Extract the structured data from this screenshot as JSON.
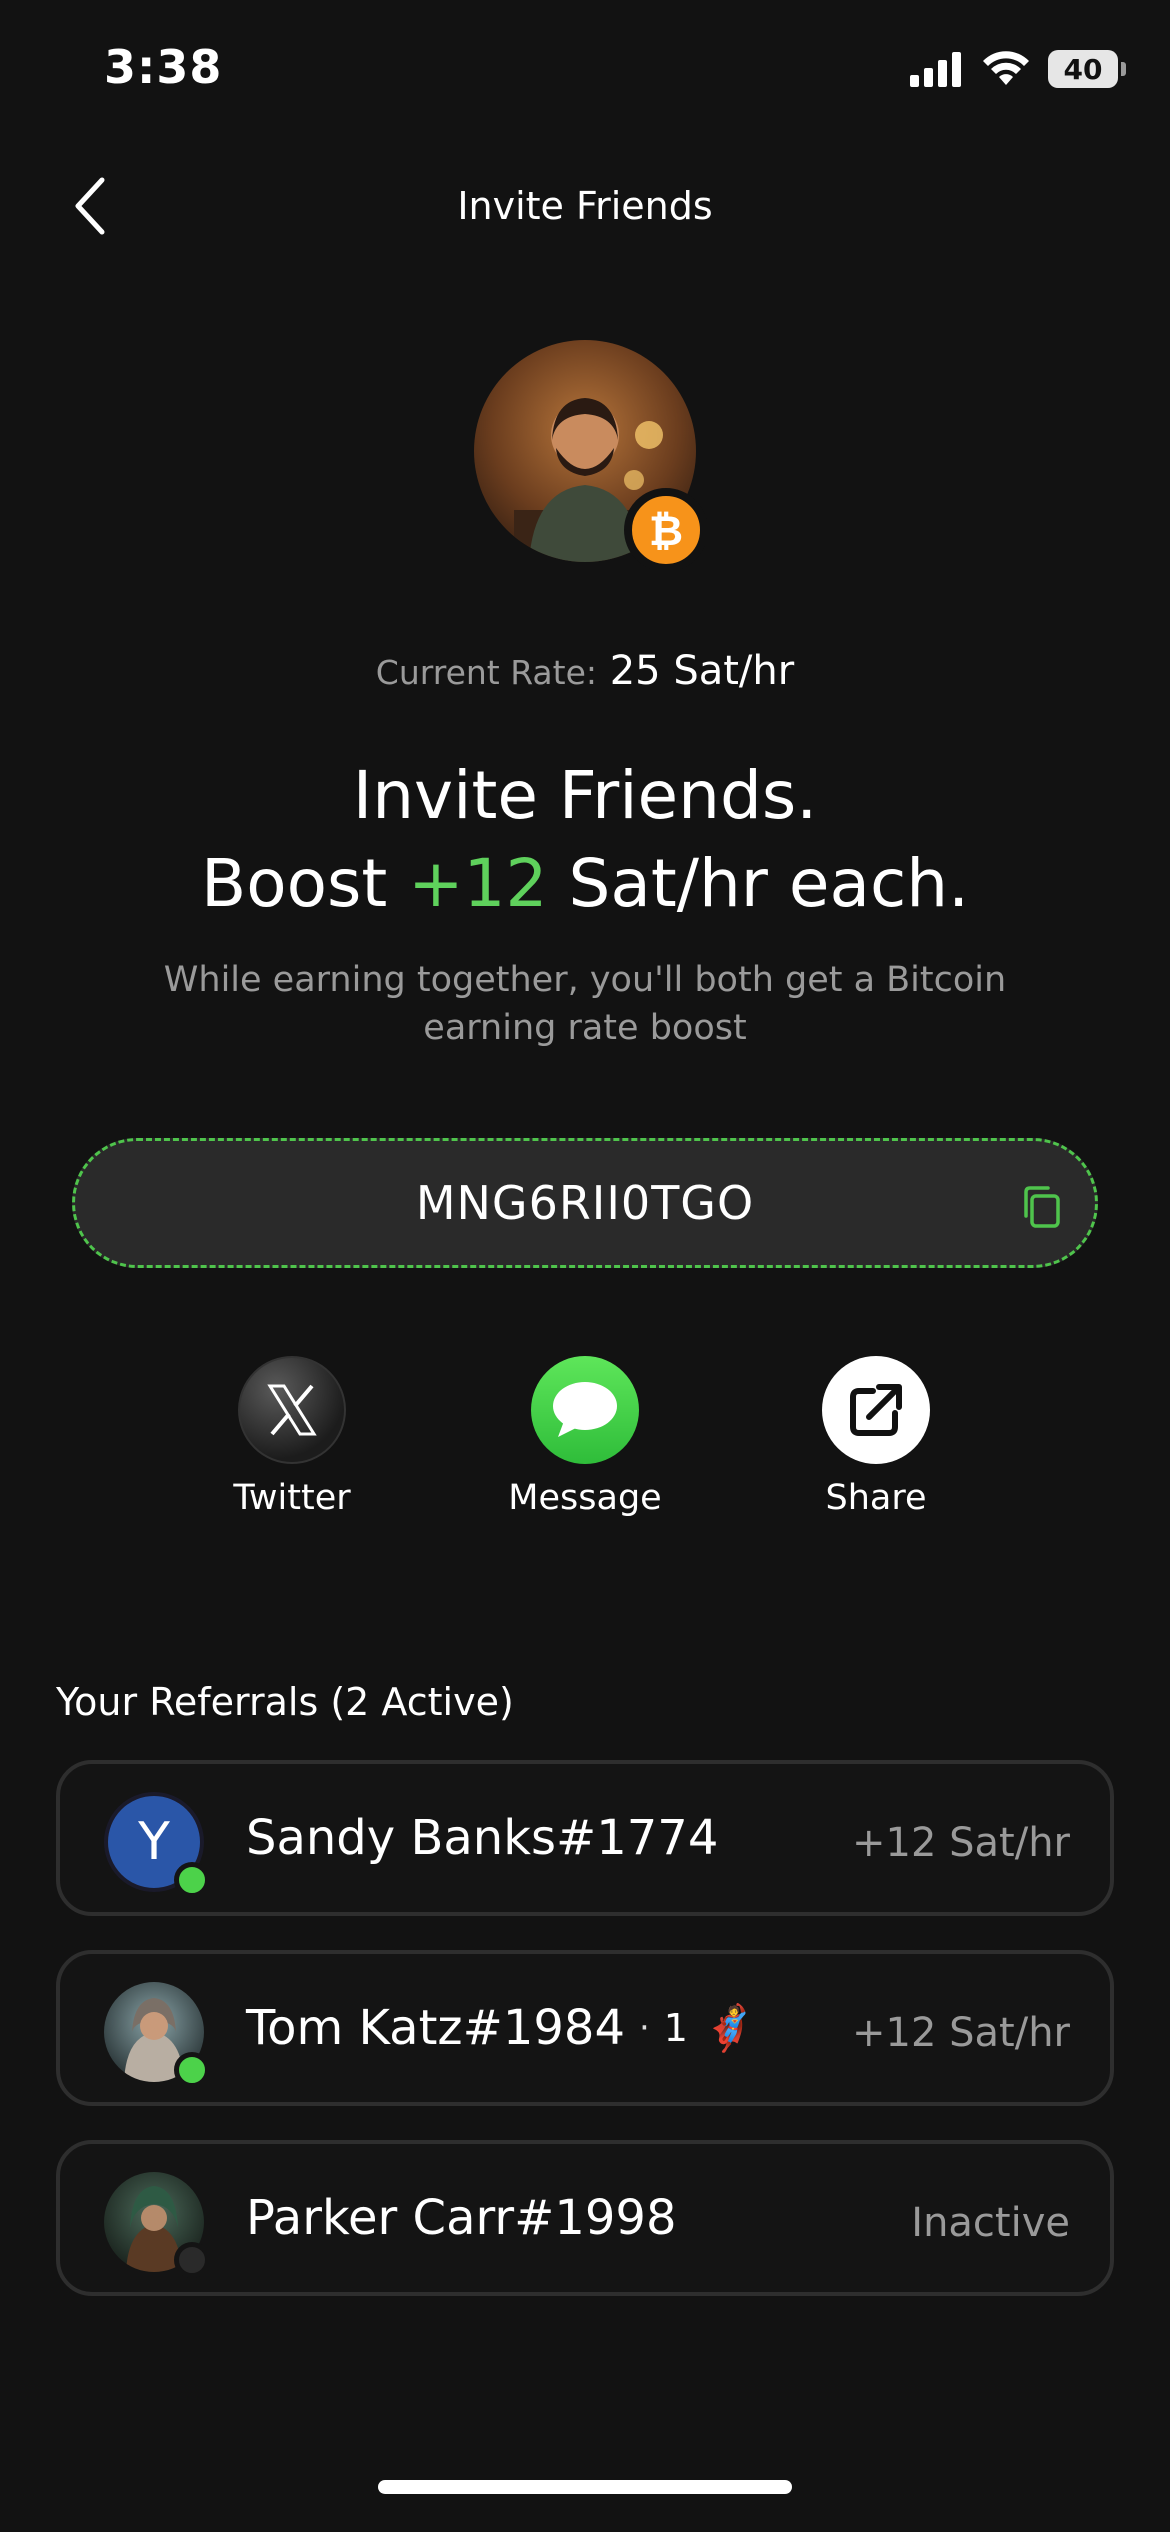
{
  "status_bar": {
    "time": "3:38",
    "battery": "40"
  },
  "header": {
    "title": "Invite Friends"
  },
  "rate": {
    "label": "Current Rate:",
    "value": "25 Sat/hr"
  },
  "headline": {
    "line1": "Invite Friends.",
    "boost_prefix": "Boost",
    "boost_value": "+12",
    "boost_suffix": "Sat/hr each."
  },
  "subtitle": "While earning together, you'll both get a Bitcoin earning rate boost",
  "invite_code": "MNG6RII0TGO",
  "share_actions": [
    {
      "label": "Twitter",
      "icon": "x-logo-icon"
    },
    {
      "label": "Message",
      "icon": "message-bubble-icon"
    },
    {
      "label": "Share",
      "icon": "share-external-icon"
    }
  ],
  "referrals": {
    "title": "Your Referrals (2 Active)",
    "items": [
      {
        "name": "Sandy Banks#1774",
        "avatar_letter": "Y",
        "status": "active",
        "rate": "+12 Sat/hr"
      },
      {
        "name": "Tom Katz#1984",
        "extra": "1",
        "extra_emoji": "🦸",
        "status": "active",
        "rate": "+12 Sat/hr"
      },
      {
        "name": "Parker Carr#1998",
        "status": "inactive",
        "rate": "Inactive"
      }
    ]
  },
  "colors": {
    "background": "#121212",
    "accent_green": "#5fd15c",
    "bitcoin_orange": "#f7931a",
    "secondary_text": "#9a9a9a",
    "message_green": "#34c759"
  }
}
